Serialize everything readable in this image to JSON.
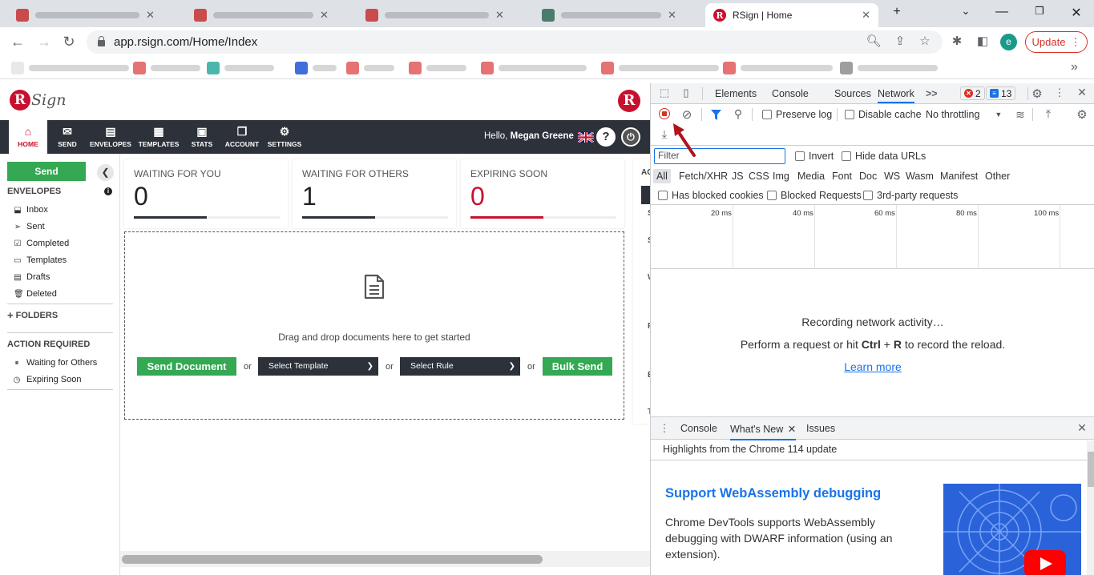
{
  "browser": {
    "active_tab_title": "RSign | Home",
    "url": "app.rsign.com/Home/Index",
    "update_label": "Update",
    "avatar_letter": "e",
    "new_tab_glyph": "+",
    "bookmarks_more": "»"
  },
  "app": {
    "logo_text": "Sign",
    "logo_letter": "R",
    "nav": [
      {
        "label": "HOME",
        "icon": "home-icon",
        "glyph": "⌂"
      },
      {
        "label": "SEND",
        "icon": "envelope-icon",
        "glyph": "✉"
      },
      {
        "label": "ENVELOPES",
        "icon": "envelopes-icon",
        "glyph": "▤"
      },
      {
        "label": "TEMPLATES",
        "icon": "templates-icon",
        "glyph": "▦"
      },
      {
        "label": "STATS",
        "icon": "briefcase-icon",
        "glyph": "▣"
      },
      {
        "label": "ACCOUNT",
        "icon": "account-icon",
        "glyph": "❐"
      },
      {
        "label": "SETTINGS",
        "icon": "gear-icon",
        "glyph": "⚙"
      }
    ],
    "hello_prefix": "Hello, ",
    "user_name": "Megan Greene",
    "sidebar": {
      "send_label": "Send",
      "envelopes_heading": "ENVELOPES",
      "items": [
        {
          "label": "Inbox",
          "glyph": "⬓"
        },
        {
          "label": "Sent",
          "glyph": "➢"
        },
        {
          "label": "Completed",
          "glyph": "☑"
        },
        {
          "label": "Templates",
          "glyph": "▭"
        },
        {
          "label": "Drafts",
          "glyph": "▤"
        },
        {
          "label": "Deleted",
          "glyph": "🗑"
        }
      ],
      "folders_label": "FOLDERS",
      "action_heading": "ACTION REQUIRED",
      "action_items": [
        {
          "label": "Waiting for Others",
          "glyph": "⏸"
        },
        {
          "label": "Expiring Soon",
          "glyph": "◷"
        }
      ]
    },
    "cards": [
      {
        "title": "WAITING FOR YOU",
        "value": "0",
        "progress": 0.5,
        "color": "#2c313a"
      },
      {
        "title": "WAITING FOR OTHERS",
        "value": "1",
        "progress": 0.5,
        "color": "#2c313a"
      },
      {
        "title": "EXPIRING SOON",
        "value": "0",
        "progress": 0.5,
        "color": "#c8102e"
      }
    ],
    "right_col_letters": [
      "AC",
      "S",
      "S",
      "W",
      "P",
      "E",
      "T"
    ],
    "dropzone": {
      "text": "Drag and drop documents here to get started",
      "send_document": "Send Document",
      "or": "or",
      "select_template": "Select Template",
      "select_rule": "Select Rule",
      "bulk_send": "Bulk Send"
    }
  },
  "devtools": {
    "tabs": [
      "Elements",
      "Console",
      "Sources",
      "Network"
    ],
    "more": ">>",
    "errors_count": "2",
    "messages_count": "13",
    "preserve_log": "Preserve log",
    "disable_cache": "Disable cache",
    "throttling": "No throttling",
    "filter_placeholder": "Filter",
    "invert": "Invert",
    "hide_data_urls": "Hide data URLs",
    "types": [
      "All",
      "Fetch/XHR",
      "JS",
      "CSS",
      "Img",
      "Media",
      "Font",
      "Doc",
      "WS",
      "Wasm",
      "Manifest",
      "Other"
    ],
    "has_blocked_cookies": "Has blocked cookies",
    "blocked_requests": "Blocked Requests",
    "third_party": "3rd-party requests",
    "timeline_ticks": [
      "20 ms",
      "40 ms",
      "60 ms",
      "80 ms",
      "100 ms"
    ],
    "recording": "Recording network activity…",
    "perform_prefix": "Perform a request or hit ",
    "ctrl": "Ctrl",
    "plus": " + ",
    "r_key": "R",
    "perform_suffix": " to record the reload.",
    "learn_more": "Learn more",
    "drawer_tabs": [
      "Console",
      "What's New",
      "Issues"
    ],
    "highlights": "Highlights from the Chrome 114 update",
    "wasm_title": "Support WebAssembly debugging",
    "wasm_desc": "Chrome DevTools supports WebAssembly debugging with DWARF information (using an extension)."
  },
  "colors": {
    "brand_red": "#c8102e",
    "nav_dark": "#2c313a",
    "green": "#34a853",
    "devtools_blue": "#1a73e8"
  }
}
